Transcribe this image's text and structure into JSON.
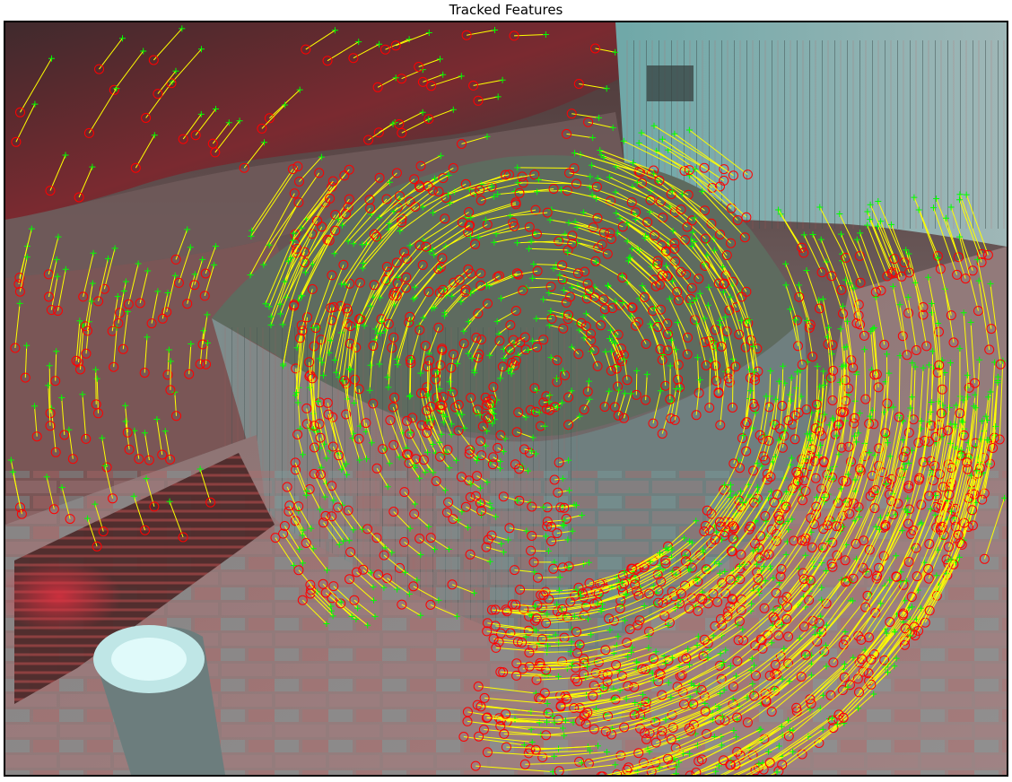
{
  "figure": {
    "title": "Tracked Features"
  },
  "colors": {
    "background": "#ffffff",
    "axes_border": "#000000",
    "motion_vector": "#ffff00",
    "tracked_point_current": "#00ff00",
    "tracked_point_previous": "#ff0000",
    "anaglyph_red": "#d0343b",
    "anaglyph_cyan": "#5fb8b6"
  },
  "image": {
    "description_visible": "",
    "legend": []
  }
}
